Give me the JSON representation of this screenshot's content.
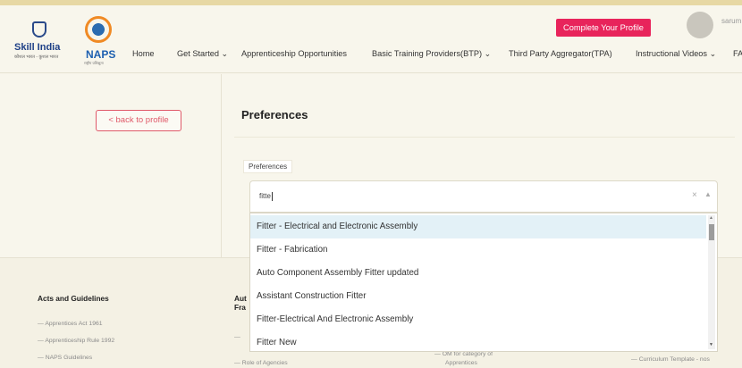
{
  "header": {
    "logo_skill_text": "Skill India",
    "logo_skill_sub": "कौशल भारत - कुशल भारत",
    "logo_naps_text": "NAPS",
    "logo_naps_sub": "राष्ट्रीय प्रशिक्षुता",
    "nav": [
      "Home",
      "Get Started ⌄",
      "Apprenticeship Opportunities",
      "Basic Training Providers(BTP) ⌄",
      "Third Party Aggregator(TPA)",
      "Instructional Videos ⌄",
      "FA"
    ],
    "cta_label": "Complete Your Profile",
    "username": "sarum"
  },
  "main": {
    "back_label": "< back to profile",
    "title": "Preferences",
    "field_label": "Preferences",
    "typed_value": "fitte",
    "clear_icon": "×",
    "arrow_icon": "▲"
  },
  "dropdown": {
    "options": [
      "Fitter - Electrical and Electronic Assembly",
      "Fitter - Fabrication",
      "Auto Component Assembly Fitter updated",
      "Assistant Construction Fitter",
      "Fitter-Electrical And Electronic Assembly",
      "Fitter New"
    ],
    "highlighted_index": 0
  },
  "footer": {
    "col1_heading": "Acts and Guidelines",
    "col1_links": [
      "Apprentices Act 1961",
      "Apprenticeship Rule 1992",
      "NAPS Guidelines"
    ],
    "col2_heading_line1": "Aut",
    "col2_heading_line2": "Fra",
    "col2_links": [
      "Role of Agencies"
    ],
    "col3_links": [
      "OM for category of",
      "Apprentices"
    ],
    "col4_links": [
      "Curriculum Template - nos"
    ]
  }
}
